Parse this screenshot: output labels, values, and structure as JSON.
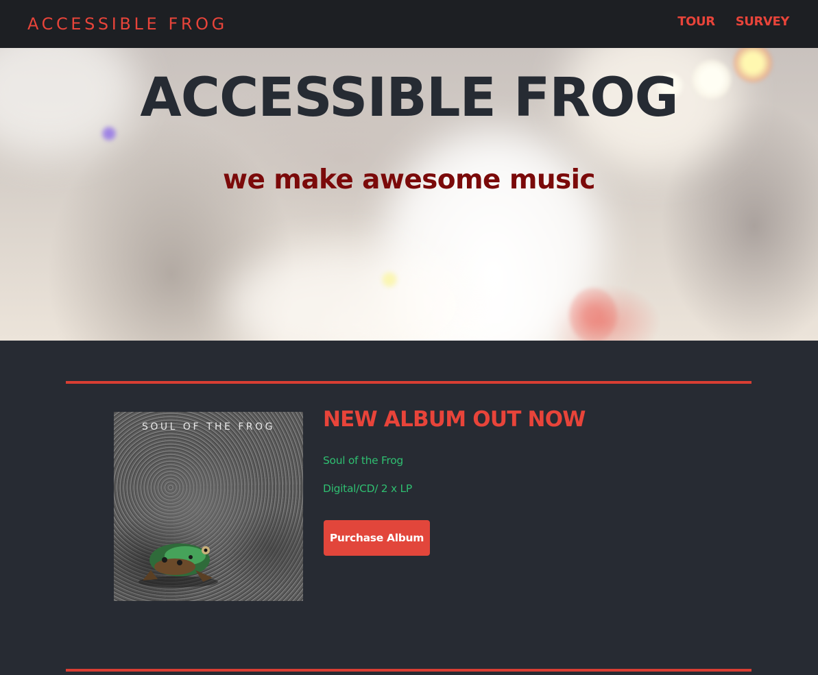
{
  "navbar": {
    "brand": "ACCESSIBLE FROG",
    "links": [
      {
        "label": "TOUR"
      },
      {
        "label": "SURVEY"
      }
    ]
  },
  "hero": {
    "title": "ACCESSIBLE FROG",
    "subtitle": "we make awesome music"
  },
  "album": {
    "cover_text": "SOUL OF THE FROG",
    "heading": "NEW ALBUM OUT NOW",
    "name": "Soul of the Frog",
    "formats": "Digital/CD/ 2 x LP",
    "purchase_label": "Purchase Album"
  },
  "colors": {
    "accent": "#e8443a",
    "navbar_bg": "#1d1f23",
    "page_bg": "#272b33",
    "hero_title": "#262b33",
    "hero_subtitle": "#7b0a0a",
    "album_text": "#2fbf71",
    "button_bg": "#e2463b"
  }
}
